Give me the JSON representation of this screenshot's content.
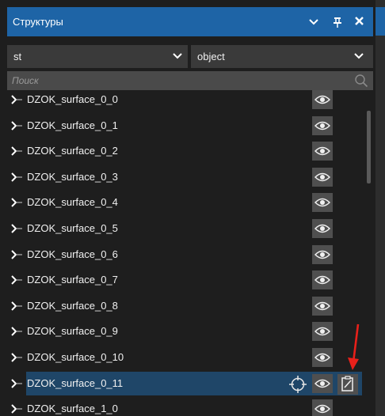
{
  "panel": {
    "title": "Структуры",
    "accent_color": "#1e64a6",
    "buttons": {
      "dropdown_icon": "chevron-down-icon",
      "pin_icon": "pin-icon",
      "close_icon": "close-icon"
    }
  },
  "filters": {
    "left_value": "st",
    "right_value": "object"
  },
  "search": {
    "placeholder": "Поиск",
    "icon": "search-icon"
  },
  "tree": {
    "items": [
      {
        "label": "DZOK_surface_0_0",
        "selected": false
      },
      {
        "label": "DZOK_surface_0_1",
        "selected": false
      },
      {
        "label": "DZOK_surface_0_2",
        "selected": false
      },
      {
        "label": "DZOK_surface_0_3",
        "selected": false
      },
      {
        "label": "DZOK_surface_0_4",
        "selected": false
      },
      {
        "label": "DZOK_surface_0_5",
        "selected": false
      },
      {
        "label": "DZOK_surface_0_6",
        "selected": false
      },
      {
        "label": "DZOK_surface_0_7",
        "selected": false
      },
      {
        "label": "DZOK_surface_0_8",
        "selected": false
      },
      {
        "label": "DZOK_surface_0_9",
        "selected": false
      },
      {
        "label": "DZOK_surface_0_10",
        "selected": false
      },
      {
        "label": "DZOK_surface_0_11",
        "selected": true
      },
      {
        "label": "DZOK_surface_1_0",
        "selected": false
      }
    ],
    "row_icons": {
      "visibility": "eye-icon",
      "focus": "target-icon",
      "edit": "edit-document-icon"
    },
    "selection_color": "#1f4668"
  },
  "annotation": {
    "arrow_color": "#e8201a"
  }
}
